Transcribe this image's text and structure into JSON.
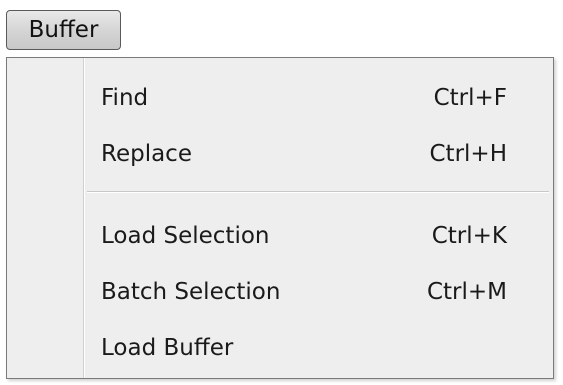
{
  "menubar": {
    "buffer_label": "Buffer"
  },
  "menu": {
    "items": [
      {
        "label": "Find",
        "shortcut": "Ctrl+F"
      },
      {
        "label": "Replace",
        "shortcut": "Ctrl+H"
      },
      {
        "label": "Load Selection",
        "shortcut": "Ctrl+K"
      },
      {
        "label": "Batch Selection",
        "shortcut": "Ctrl+M"
      },
      {
        "label": "Load Buffer",
        "shortcut": ""
      }
    ]
  }
}
